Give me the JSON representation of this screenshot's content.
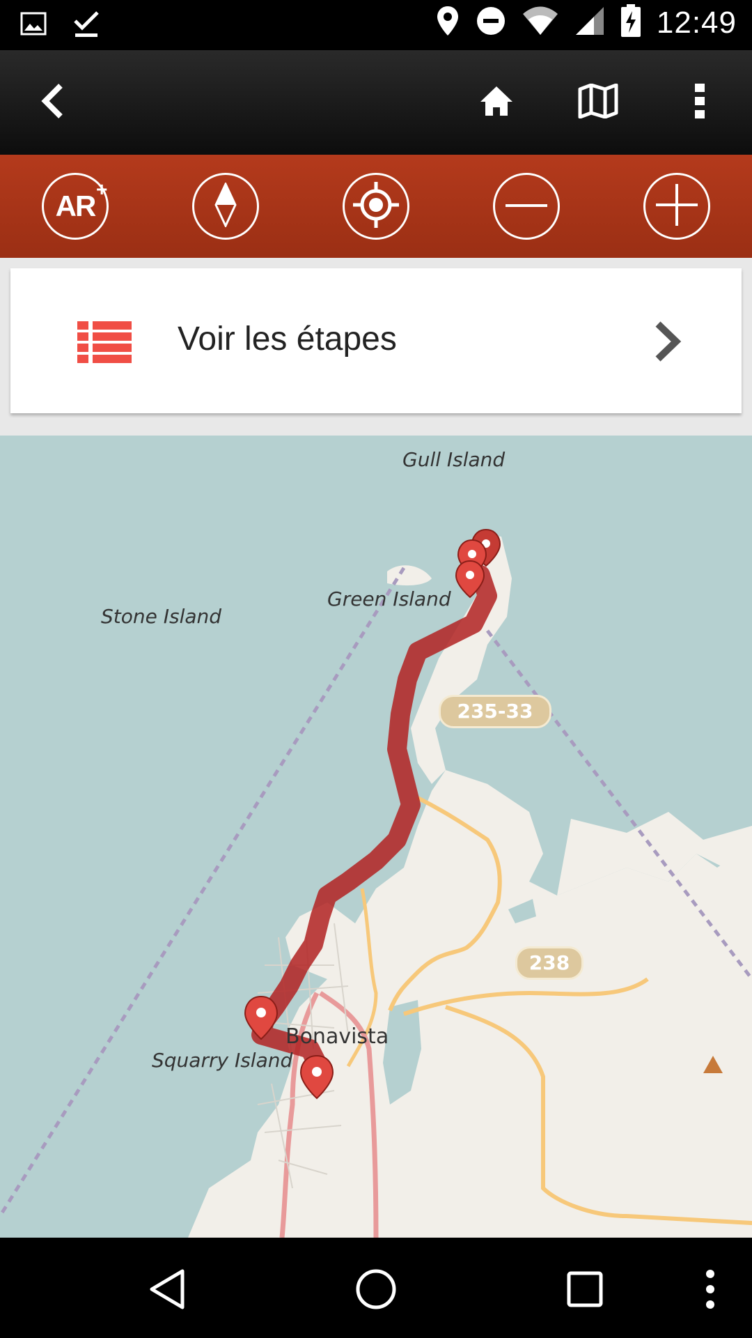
{
  "status_bar": {
    "time": "12:49",
    "left_icons": [
      "image-icon",
      "download-done-icon"
    ],
    "right_icons": [
      "location-icon",
      "do-not-disturb-icon",
      "wifi-icon",
      "signal-icon",
      "battery-charging-icon"
    ]
  },
  "app_bar": {
    "back_icon": "back-arrow-icon",
    "actions": [
      "home-icon",
      "map-icon",
      "more-vert-icon"
    ]
  },
  "map_toolbar": {
    "ar_label": "AR",
    "ar_plus": "+",
    "tools": [
      "ar-icon",
      "compass-icon",
      "locate-icon",
      "zoom-out-icon",
      "zoom-in-icon"
    ]
  },
  "stages_card": {
    "label": "Voir les étapes",
    "icon": "list-icon",
    "chevron": "chevron-right-icon"
  },
  "map": {
    "labels": {
      "gull_island": "Gull Island",
      "green_island": "Green Island",
      "stone_island": "Stone Island",
      "squarry_island": "Squarry Island",
      "bonavista": "Bonavista"
    },
    "road_shields": {
      "route_a": "235-33",
      "route_b": "238"
    },
    "route_color": "#b22222",
    "water_color": "#b5d0d0",
    "land_color": "#f2efe9"
  },
  "nav_bar": {
    "buttons": [
      "back-triangle-icon",
      "home-circle-icon",
      "recents-square-icon",
      "more-dots-icon"
    ]
  }
}
